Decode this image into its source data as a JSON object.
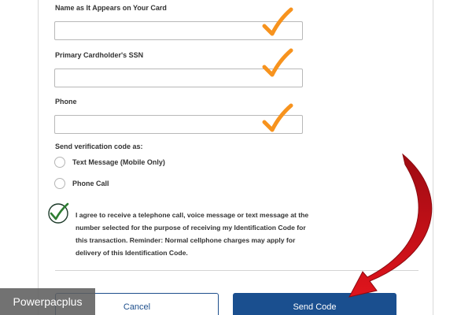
{
  "form": {
    "name_field": {
      "label": "Name as It Appears on Your Card",
      "value": "",
      "placeholder": ""
    },
    "ssn_field": {
      "label": "Primary Cardholder's SSN",
      "value": "",
      "placeholder": ""
    },
    "phone_field": {
      "label": "Phone",
      "value": "",
      "placeholder": ""
    },
    "verification": {
      "label": "Send verification code as:",
      "options": [
        {
          "label": "Text Message (Mobile Only)",
          "selected": false
        },
        {
          "label": "Phone Call",
          "selected": false
        }
      ]
    },
    "consent": {
      "checked": true,
      "text": "I agree to receive a telephone call, voice message or text message at the number selected for the purpose of receiving my Identification Code for this transaction. Reminder: Normal cellphone charges may apply for delivery of this Identification Code."
    },
    "buttons": {
      "cancel_label": "Cancel",
      "send_label": "Send Code"
    }
  },
  "annotations": {
    "orange_check_icon": "orange-checkmark",
    "arrow_icon": "red-curved-arrow",
    "accent_orange": "#f7931e",
    "arrow_red": "#d0101a",
    "button_blue": "#1a4f8f",
    "consent_green": "#2e7d32"
  },
  "watermark": {
    "text": "Powerpacplus"
  }
}
